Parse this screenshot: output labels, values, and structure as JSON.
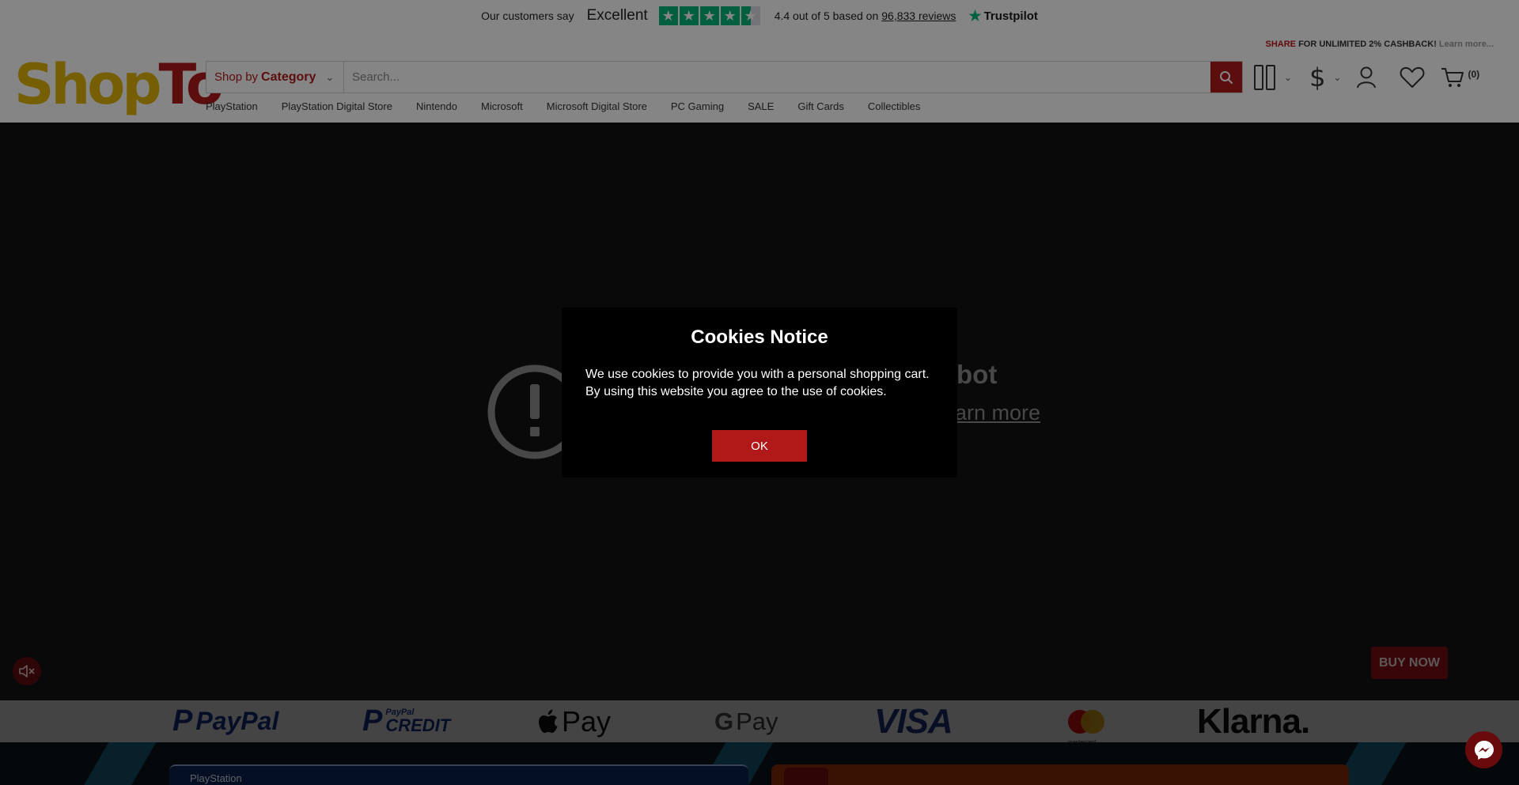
{
  "trustpilot": {
    "intro": "Our customers say",
    "verdict": "Excellent",
    "rating_text": "4.4 out of 5 based on",
    "reviews_link": "96,833 reviews",
    "brand": "Trustpilot"
  },
  "header": {
    "logo_part1": "Shop",
    "logo_part2": "To",
    "promo_share": "SHARE",
    "promo_text": "FOR UNLIMITED 2% CASHBACK!",
    "promo_learn": "Learn more...",
    "search": {
      "category_prefix": "Shop by",
      "category_bold": "Category",
      "placeholder": "Search..."
    },
    "cart_count": "(0)",
    "currency_symbol": "$"
  },
  "nav": {
    "items": [
      {
        "label": "PlayStation"
      },
      {
        "label": "PlayStation Digital Store"
      },
      {
        "label": "Nintendo"
      },
      {
        "label": "Microsoft"
      },
      {
        "label": "Microsoft Digital Store"
      },
      {
        "label": "PC Gaming"
      },
      {
        "label": "SALE"
      },
      {
        "label": "Gift Cards"
      },
      {
        "label": "Collectibles"
      }
    ]
  },
  "hero": {
    "text_line1": "bot",
    "text_line2": "arn more",
    "buy_now": "BUY NOW"
  },
  "payments": {
    "paypal": "PayPal",
    "paypal_credit_top": "PayPal",
    "paypal_credit_bottom": "CREDIT",
    "apple_pay": "Pay",
    "google_pay": "Pay",
    "google_g": "G",
    "visa": "VISA",
    "mastercard": "mastercard",
    "klarna": "Klarna."
  },
  "banners": {
    "playstation_label": "PlayStation"
  },
  "cookie_modal": {
    "title": "Cookies Notice",
    "body": "We use cookies to provide you with a personal shopping cart. By using this website you agree to the use of cookies.",
    "ok_label": "OK"
  },
  "colors": {
    "brand_red": "#b11919",
    "brand_yellow": "#e3b40a",
    "trustpilot_green": "#00b67a"
  }
}
